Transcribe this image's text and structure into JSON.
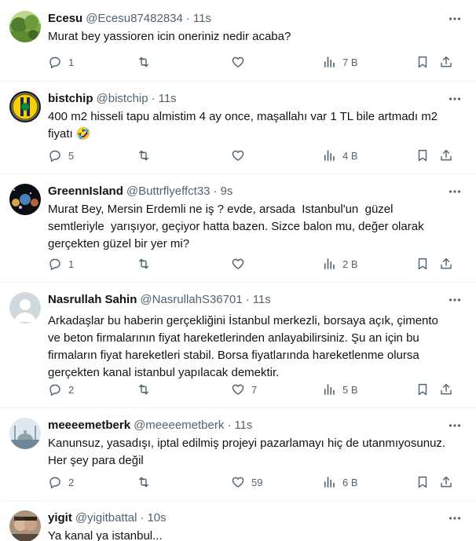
{
  "tweets": [
    {
      "name": "Ecesu",
      "handle": "@Ecesu87482834",
      "sep": "·",
      "time": "11s",
      "text": "Murat bey yassioren icin oneriniz nedir acaba?",
      "replies": "1",
      "retweets": "",
      "likes": "",
      "views": "7 B",
      "avatar": "landscape"
    },
    {
      "name": "bistchip",
      "handle": "@bistchip",
      "sep": "·",
      "time": "11s",
      "text": "400 m2 hisseli tapu almistim 4 ay once, maşallahı var 1 TL bile artmadı m2\nfiyatı 🤣",
      "replies": "5",
      "retweets": "",
      "likes": "",
      "views": "4 B",
      "avatar": "club-crest"
    },
    {
      "name": "GreennIsland",
      "handle": "@Buttrflyeffct33",
      "sep": "·",
      "time": "9s",
      "text": "Murat Bey, Mersin Erdemli ne iş ? evde, arsada  Istanbul'un  güzel\nsemtleriyle  yarışıyor, geçiyor hatta bazen. Sizce balon mu, değer olarak\ngerçekten güzel bir yer mi?",
      "replies": "1",
      "retweets": "",
      "likes": "",
      "views": "2 B",
      "avatar": "planets"
    },
    {
      "name": "Nasrullah Sahin",
      "handle": "@NasrullahS36701",
      "sep": "·",
      "time": "11s",
      "text": "Arkadaşlar bu haberin gerçekliğini İstanbul merkezli, borsaya açık, çimento\nve beton firmalarının fiyat hareketlerinden anlayabilirsiniz. Şu an için bu\nfirmaların fiyat hareketleri stabil. Borsa fiyatlarında hareketlenme olursa\ngerçekten kanal istanbul yapılacak demektir.",
      "replies": "2",
      "retweets": "",
      "likes": "7",
      "views": "5 B",
      "avatar": "default"
    },
    {
      "name": "meeeemetberk",
      "handle": "@meeeemetberk",
      "sep": "·",
      "time": "11s",
      "text": "Kanunsuz, yasadışı, iptal edilmiş projeyi pazarlamayı hiç de utanmıyosunuz.\nHer şey para değil",
      "replies": "2",
      "retweets": "",
      "likes": "59",
      "views": "6 B",
      "avatar": "mosque"
    },
    {
      "name": "yigit",
      "handle": "@yigitbattal",
      "sep": "·",
      "time": "10s",
      "text": "Ya kanal ya istanbul...",
      "avatar": "photo"
    }
  ],
  "icons": {
    "more": "more-horizontal-icon",
    "reply": "reply-bubble-icon",
    "retweet": "retweet-icon",
    "like": "heart-icon",
    "views": "views-bars-icon",
    "bookmark": "bookmark-icon",
    "share": "share-upload-icon"
  },
  "colors": {
    "text": "#0f1419",
    "secondary": "#536471",
    "divider": "#eff3f4",
    "background": "#ffffff"
  }
}
